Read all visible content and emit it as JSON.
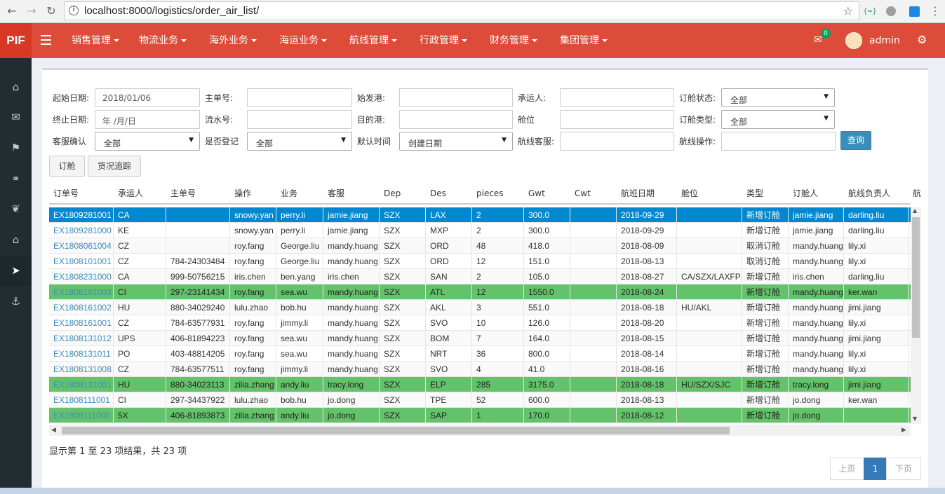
{
  "browser": {
    "url": "localhost:8000/logistics/order_air_list/",
    "back": "←",
    "forward": "→",
    "reload": "↻",
    "info": "i",
    "star": "☆"
  },
  "app": {
    "logo": "PIF",
    "menu": [
      "销售管理",
      "物流业务",
      "海外业务",
      "海运业务",
      "航线管理",
      "行政管理",
      "财务管理",
      "集团管理"
    ],
    "mail_icon": "✉",
    "mail_badge": "0",
    "user": "admin",
    "gears_icon": "⚙"
  },
  "sidebar": {
    "icons": [
      "home-icon",
      "mail-icon",
      "flag-icon",
      "link-icon",
      "leaf-icon",
      "bank-icon",
      "rocket-icon",
      "anchor-icon"
    ],
    "glyphs": [
      "⌂",
      "✉",
      "⚑",
      "⚭",
      "❦",
      "⌂",
      "➤",
      "⚓"
    ]
  },
  "filters": {
    "start_date_label": "起始日期:",
    "start_date_value": "2018/01/06",
    "end_date_label": "终止日期:",
    "end_date_value": "年 /月/日",
    "cs_confirm_label": "客服确认",
    "cs_confirm_value": "全部",
    "master_no_label": "主单号:",
    "serial_no_label": "流水号:",
    "registered_label": "是否登记",
    "registered_value": "全部",
    "origin_label": "始发港:",
    "dest_label": "目的港:",
    "default_time_label": "默认时间",
    "default_time_value": "创建日期",
    "carrier_label": "承运人:",
    "cabin_label": "舱位",
    "route_cs_label": "航线客服:",
    "status_label": "订舱状态:",
    "status_value": "全部",
    "type_label": "订舱类型:",
    "type_value": "全部",
    "route_op_label": "航线操作:",
    "query_button": "查询",
    "book_button": "订舱",
    "track_button": "货况追踪"
  },
  "table": {
    "columns": [
      "订单号",
      "承运人",
      "主单号",
      "操作",
      "业务",
      "客服",
      "Dep",
      "Des",
      "pieces",
      "Gwt",
      "Cwt",
      "航班日期",
      "舱位",
      "类型",
      "订舱人",
      "航线负责人",
      "航"
    ],
    "rows": [
      [
        "EX1809281001",
        "CA",
        "",
        "snowy.yan",
        "perry.li",
        "jamie.jiang",
        "SZX",
        "LAX",
        "2",
        "300.0",
        "",
        "2018-09-29",
        "",
        "新增订舱",
        "jamie.jiang",
        "darling.liu"
      ],
      [
        "EX1809281000",
        "KE",
        "",
        "snowy.yan",
        "perry.li",
        "jamie.jiang",
        "SZX",
        "MXP",
        "2",
        "300.0",
        "",
        "2018-09-29",
        "",
        "新增订舱",
        "jamie.jiang",
        "darling.liu"
      ],
      [
        "EX1808061004",
        "CZ",
        "",
        "roy.fang",
        "George.liu",
        "mandy.huang",
        "SZX",
        "ORD",
        "48",
        "418.0",
        "",
        "2018-08-09",
        "",
        "取消订舱",
        "mandy.huang",
        "lily.xi"
      ],
      [
        "EX1808101001",
        "CZ",
        "784-24303484",
        "roy.fang",
        "George.liu",
        "mandy.huang",
        "SZX",
        "ORD",
        "12",
        "151.0",
        "",
        "2018-08-13",
        "",
        "取消订舱",
        "mandy.huang",
        "lily.xi"
      ],
      [
        "EX1808231000",
        "CA",
        "999-50756215",
        "iris.chen",
        "ben.yang",
        "iris.chen",
        "SZX",
        "SAN",
        "2",
        "105.0",
        "",
        "2018-08-27",
        "CA/SZX/LAXFP",
        "新增订舱",
        "iris.chen",
        "darling.liu"
      ],
      [
        "EX1808161003",
        "CI",
        "297-23141434",
        "roy.fang",
        "sea.wu",
        "mandy.huang",
        "SZX",
        "ATL",
        "12",
        "1550.0",
        "",
        "2018-08-24",
        "",
        "新增订舱",
        "mandy.huang",
        "ker.wan"
      ],
      [
        "EX1808161002",
        "HU",
        "880-34029240",
        "lulu.zhao",
        "bob.hu",
        "mandy.huang",
        "SZX",
        "AKL",
        "3",
        "551.0",
        "",
        "2018-08-18",
        "HU/AKL",
        "新增订舱",
        "mandy.huang",
        "jimi.jiang"
      ],
      [
        "EX1808161001",
        "CZ",
        "784-63577931",
        "roy.fang",
        "jimmy.li",
        "mandy.huang",
        "SZX",
        "SVO",
        "10",
        "126.0",
        "",
        "2018-08-20",
        "",
        "新增订舱",
        "mandy.huang",
        "lily.xi"
      ],
      [
        "EX1808131012",
        "UPS",
        "406-81894223",
        "roy.fang",
        "sea.wu",
        "mandy.huang",
        "SZX",
        "BOM",
        "7",
        "164.0",
        "",
        "2018-08-15",
        "",
        "新增订舱",
        "mandy.huang",
        "jimi.jiang"
      ],
      [
        "EX1808131011",
        "PO",
        "403-48814205",
        "roy.fang",
        "sea.wu",
        "mandy.huang",
        "SZX",
        "NRT",
        "36",
        "800.0",
        "",
        "2018-08-14",
        "",
        "新增订舱",
        "mandy.huang",
        "lily.xi"
      ],
      [
        "EX1808131008",
        "CZ",
        "784-63577511",
        "roy.fang",
        "jimmy.li",
        "mandy.huang",
        "SZX",
        "SVO",
        "4",
        "41.0",
        "",
        "2018-08-16",
        "",
        "新增订舱",
        "mandy.huang",
        "lily.xi"
      ],
      [
        "EX1808131001",
        "HU",
        "880-34023113",
        "zilia.zhang",
        "andy.liu",
        "tracy.long",
        "SZX",
        "ELP",
        "285",
        "3175.0",
        "",
        "2018-08-18",
        "HU/SZX/SJC",
        "新增订舱",
        "tracy.long",
        "jimi.jiang"
      ],
      [
        "EX1808111001",
        "CI",
        "297-34437922",
        "lulu.zhao",
        "bob.hu",
        "jo.dong",
        "SZX",
        "TPE",
        "52",
        "600.0",
        "",
        "2018-08-13",
        "",
        "新增订舱",
        "jo.dong",
        "ker.wan"
      ],
      [
        "EX1808111000",
        "5X",
        "406-81893873",
        "zilia.zhang",
        "andy.liu",
        "jo.dong",
        "SZX",
        "SAP",
        "1",
        "170.0",
        "",
        "2018-08-12",
        "",
        "新增订舱",
        "jo.dong",
        ""
      ]
    ],
    "row_styles": [
      "selected",
      "plain",
      "odd",
      "plain",
      "odd",
      "green",
      "odd",
      "plain",
      "odd",
      "plain",
      "odd",
      "green",
      "odd",
      "green"
    ]
  },
  "footer": {
    "info": "显示第 1 至 23 项结果，共 23 项",
    "prev": "上页",
    "page": "1",
    "next": "下页"
  },
  "colors": {
    "header": "#dd4b39",
    "sidebar": "#222d32",
    "selected_row": "#0288d1",
    "green_row": "#64c26b",
    "primary": "#3c8dbc"
  }
}
